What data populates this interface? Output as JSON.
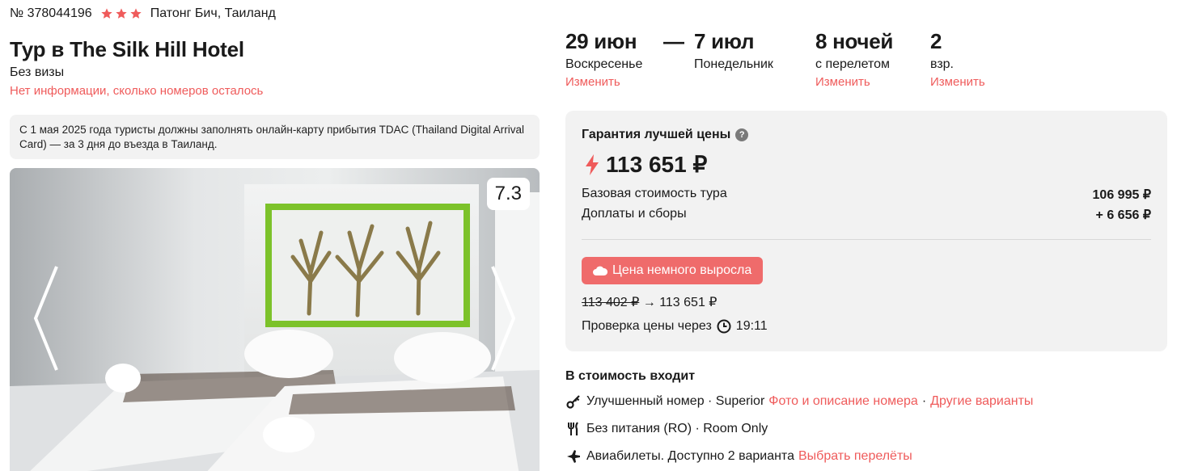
{
  "tour": {
    "number": "№ 378044196",
    "stars": 3,
    "location": "Патонг Бич, Таиланд",
    "title": "Тур в The Silk Hill Hotel",
    "visa": "Без визы",
    "rooms_note": "Нет информации, сколько номеров осталось"
  },
  "notice": {
    "text": "С 1 мая 2025 года туристы должны заполнять онлайн-карту прибытия TDAC (Thailand Digital Arrival Card) — за 3 дня до въезда в Таиланд."
  },
  "gallery": {
    "rating": "7.3"
  },
  "dates": {
    "dash": "—",
    "start": {
      "big": "29 июн",
      "sub": "Воскресенье",
      "change": "Изменить"
    },
    "end": {
      "big": "7 июл",
      "sub": "Понедельник"
    },
    "nights": {
      "big": "8 ночей",
      "sub": "с перелетом",
      "change": "Изменить"
    },
    "guests": {
      "big": "2",
      "sub": "взр.",
      "change": "Изменить"
    }
  },
  "price": {
    "guarantee": "Гарантия лучшей цены",
    "info": "?",
    "total": "113 651 ₽",
    "base_label": "Базовая стоимость тура",
    "base_value": "106 995 ₽",
    "fees_label": "Доплаты и сборы",
    "fees_value": "+ 6 656 ₽",
    "badge": "Цена немного выросла",
    "old_price": "113 402 ₽",
    "arrow": "→",
    "new_price": "113 651 ₽",
    "check_label": "Проверка цены через",
    "check_time": "19:11"
  },
  "included": {
    "title": "В стоимость входит",
    "room": {
      "text": "Улучшенный номер · Superior",
      "link1": "Фото и описание номера",
      "sep": "·",
      "link2": "Другие варианты"
    },
    "meal": {
      "text": "Без питания (RO) · Room Only"
    },
    "flight": {
      "text": "Авиабилеты. Доступно 2 варианта",
      "link": "Выбрать перелёты"
    }
  },
  "colors": {
    "accent": "#ef5b5b",
    "badge": "#ef6b6b",
    "card": "#f2f2f2"
  }
}
